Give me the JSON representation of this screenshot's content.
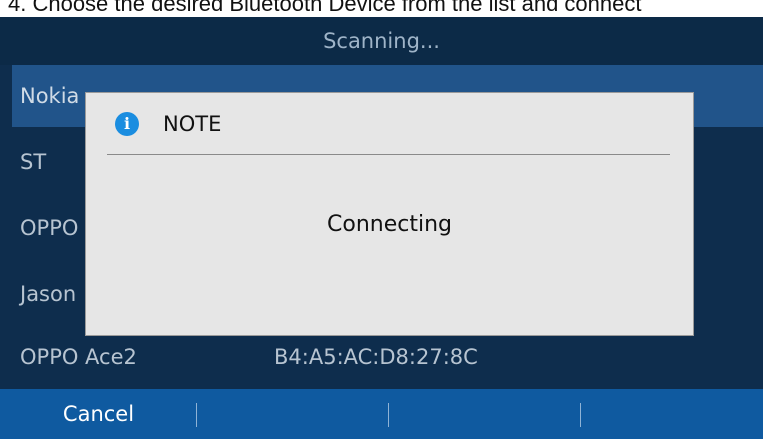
{
  "caption": "4. Choose the desired Bluetooth Device from the list and connect",
  "status": {
    "text": "Scanning..."
  },
  "devices": [
    {
      "name": "Nokia",
      "mac": ""
    },
    {
      "name": "ST",
      "mac": ""
    },
    {
      "name": "OPPO",
      "mac": ""
    },
    {
      "name": "Jason",
      "mac": ""
    },
    {
      "name": "OPPO Ace2",
      "mac": "B4:A5:AC:D8:27:8C"
    }
  ],
  "dialog": {
    "title": "NOTE",
    "message": "Connecting",
    "icon": "info-icon"
  },
  "softkeys": {
    "cancel_label": "Cancel"
  },
  "colors": {
    "background": "#0e2d4d",
    "selected_row": "#21548a",
    "softkey_bar": "#0f5aa0",
    "dialog": "#e6e6e6",
    "info_icon": "#1a8de0"
  }
}
